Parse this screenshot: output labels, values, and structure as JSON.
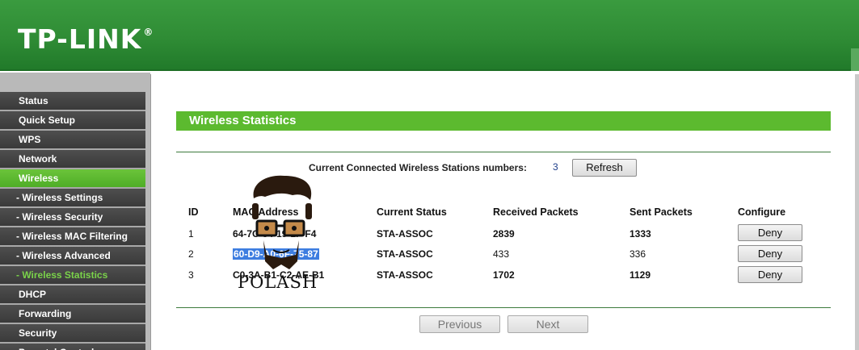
{
  "header": {
    "brand": "TP-LINK",
    "reg_mark": "®"
  },
  "menu": [
    {
      "label": "Status",
      "type": "main"
    },
    {
      "label": "Quick Setup",
      "type": "main"
    },
    {
      "label": "WPS",
      "type": "main"
    },
    {
      "label": "Network",
      "type": "main"
    },
    {
      "label": "Wireless",
      "type": "main",
      "active": true
    },
    {
      "label": "- Wireless Settings",
      "type": "sub"
    },
    {
      "label": "- Wireless Security",
      "type": "sub"
    },
    {
      "label": "- Wireless MAC Filtering",
      "type": "sub"
    },
    {
      "label": "- Wireless Advanced",
      "type": "sub"
    },
    {
      "label": "- Wireless Statistics",
      "type": "sub",
      "active": true
    },
    {
      "label": "DHCP",
      "type": "main"
    },
    {
      "label": "Forwarding",
      "type": "main"
    },
    {
      "label": "Security",
      "type": "main"
    },
    {
      "label": "Parental Control",
      "type": "main"
    }
  ],
  "page": {
    "title": "Wireless Statistics",
    "stations_label": "Current Connected Wireless Stations numbers:",
    "stations_count": "3",
    "refresh_label": "Refresh"
  },
  "table": {
    "headers": {
      "id": "ID",
      "mac": "MAC Address",
      "status": "Current Status",
      "received": "Received Packets",
      "sent": "Sent Packets",
      "configure": "Configure"
    },
    "rows": [
      {
        "id": "1",
        "mac": "64-7C-34-19-1F-F4",
        "status": "STA-ASSOC",
        "received": "2839",
        "sent": "1333",
        "action": "Deny"
      },
      {
        "id": "2",
        "mac": "60-D9-A0-6F-75-87",
        "status": "STA-ASSOC",
        "received": "433",
        "sent": "336",
        "action": "Deny"
      },
      {
        "id": "3",
        "mac": "C0-3A-B1-C2-AE-B1",
        "status": "STA-ASSOC",
        "received": "1702",
        "sent": "1129",
        "action": "Deny"
      }
    ]
  },
  "pagination": {
    "previous": "Previous",
    "next": "Next"
  },
  "watermark": {
    "text": "POLASH"
  },
  "colors": {
    "brand_green": "#2f8c35",
    "accent_green": "#5cba2f",
    "menu_dark": "#3a3a3a",
    "selection_blue": "#3d7de0"
  }
}
